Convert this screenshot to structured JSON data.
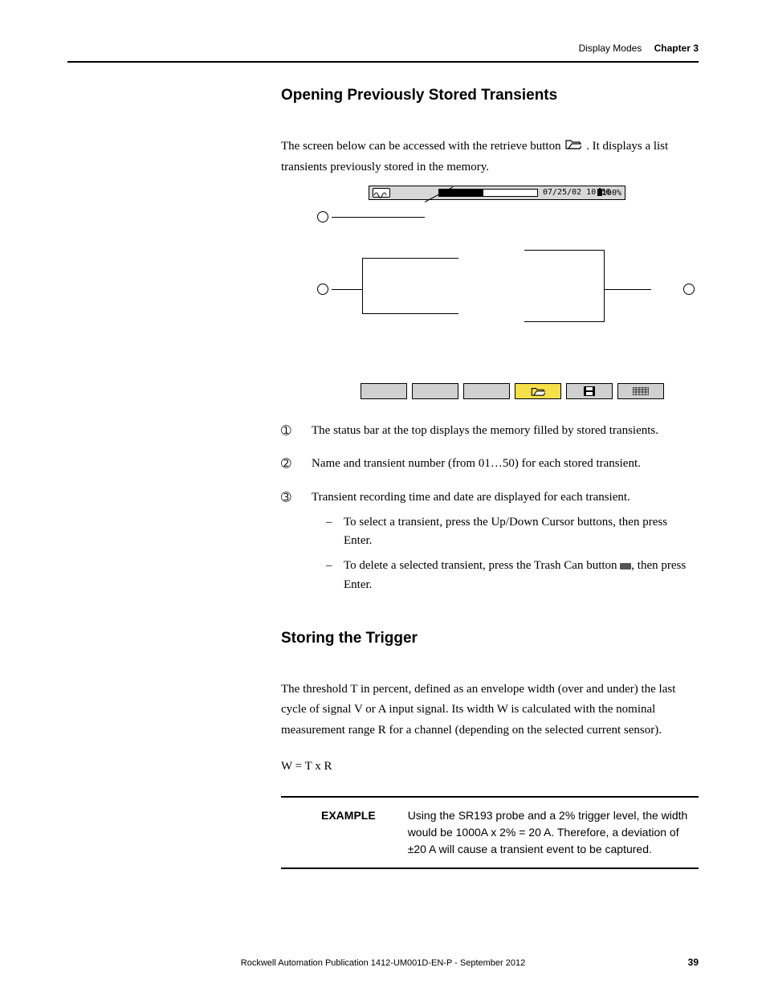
{
  "header": {
    "section": "Display Modes",
    "chapter": "Chapter 3"
  },
  "section1": {
    "heading": "Opening Previously Stored Transients",
    "intro_a": "The screen below can be accessed with the retrieve button ",
    "intro_b": " . It displays a list transients previously stored in the memory.",
    "status_date": "07/25/02 10:56",
    "status_batt": "100%",
    "items": {
      "n1": "➀",
      "t1": "The status bar at the top displays the memory filled by stored transients.",
      "n2": "➁",
      "t2": "Name and transient number (from 01…50) for each stored transient.",
      "n3": "➂",
      "t3": "Transient recording time and date are displayed for each transient.",
      "s1": "To select a transient, press the Up/Down Cursor buttons, then press Enter.",
      "s2a": "To delete a selected transient, press the Trash Can button ",
      "s2b": ", then press Enter."
    }
  },
  "section2": {
    "heading": "Storing the Trigger",
    "para": "The threshold T in percent, defined as an envelope width (over and under) the last cycle of signal V or A input signal. Its width W is calculated with the nominal measurement range R for a channel (depending on the selected current sensor).",
    "formula": "W = T x R",
    "example_label": "EXAMPLE",
    "example_text": "Using the SR193 probe and a 2% trigger level, the width would be 1000A x 2% = 20 A. Therefore, a deviation of ±20 A will cause a transient event to be captured."
  },
  "footer": {
    "pub": "Rockwell Automation Publication 1412-UM001D-EN-P - September 2012",
    "page": "39"
  }
}
